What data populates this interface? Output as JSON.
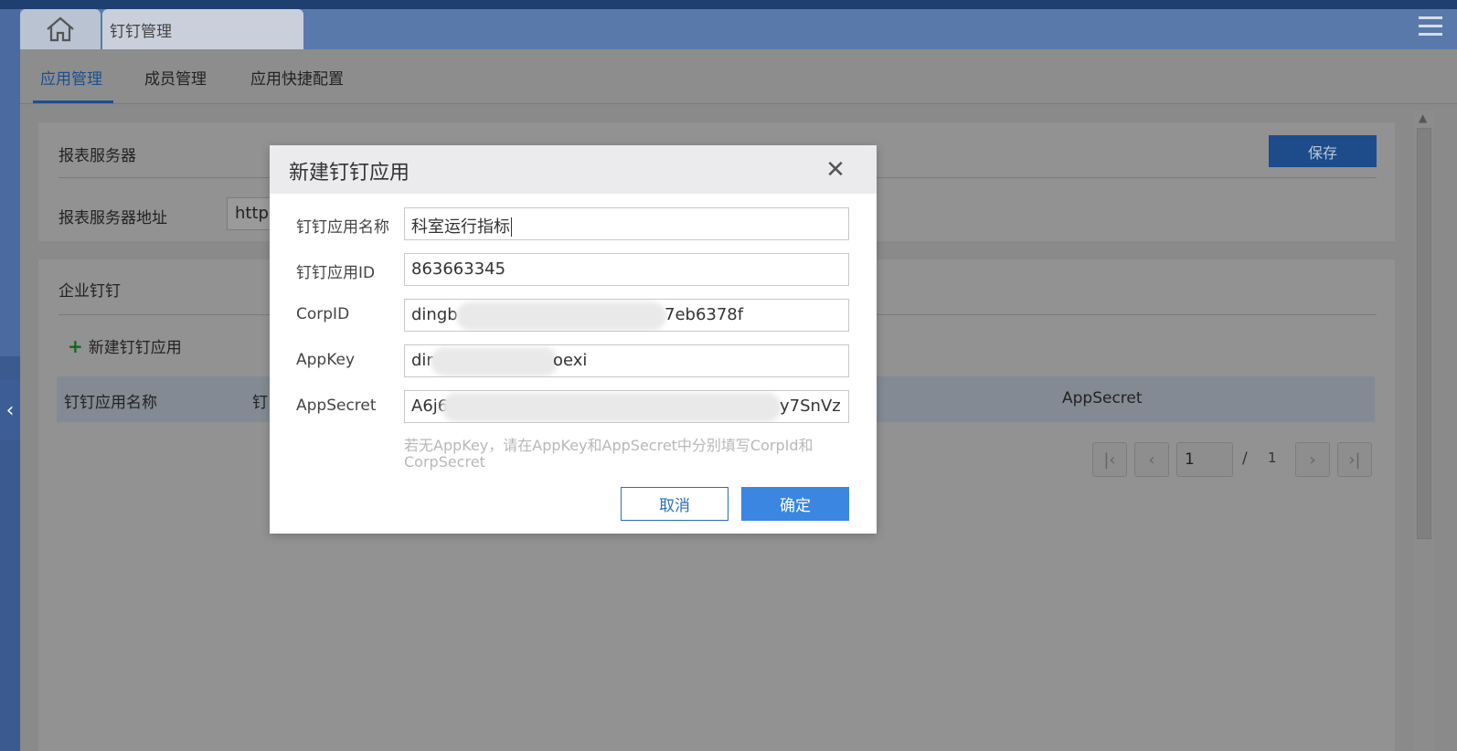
{
  "header": {
    "page_tab_label": "钉钉管理"
  },
  "subnav": {
    "tabs": [
      {
        "label": "应用管理"
      },
      {
        "label": "成员管理"
      },
      {
        "label": "应用快捷配置"
      }
    ]
  },
  "report_server": {
    "section_title": "报表服务器",
    "save_label": "保存",
    "address_label": "报表服务器地址",
    "address_value": "http:"
  },
  "enterprise": {
    "section_title": "企业钉钉",
    "new_app_label": "新建钉钉应用",
    "table_headers": [
      "钉钉应用名称",
      "钉",
      "AppSecret"
    ]
  },
  "pager": {
    "current_page": "1",
    "separator": "/",
    "total_pages": "1"
  },
  "modal": {
    "title": "新建钉钉应用",
    "fields": [
      {
        "label": "钉钉应用名称",
        "value": "科室运行指标"
      },
      {
        "label": "钉钉应用ID",
        "value": "863663345"
      },
      {
        "label": "CorpID",
        "value_start": "dingb",
        "value_end": "7eb6378f"
      },
      {
        "label": "AppKey",
        "value_start": "dir",
        "value_end": "oexi"
      },
      {
        "label": "AppSecret",
        "value_start": "A6j6",
        "value_end": "y7SnVz"
      }
    ],
    "hint": "若无AppKey，请在AppKey和AppSecret中分别填写CorpId和CorpSecret",
    "cancel_label": "取消",
    "ok_label": "确定"
  }
}
